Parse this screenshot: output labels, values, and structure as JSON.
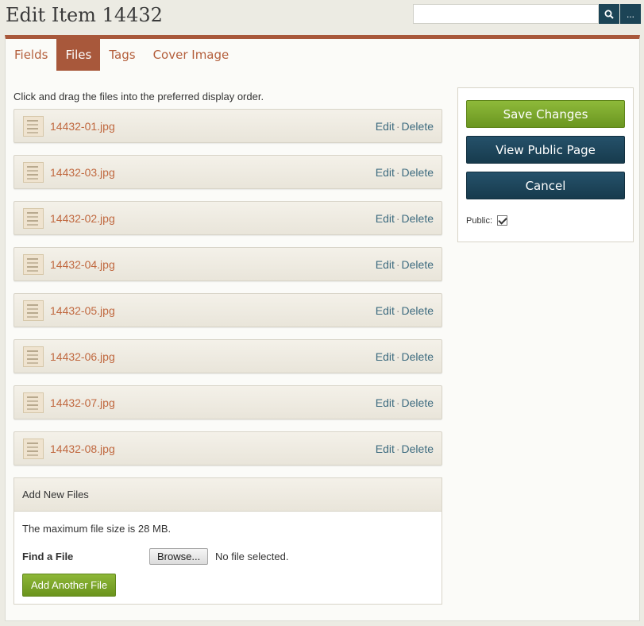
{
  "header": {
    "title": "Edit Item 14432"
  },
  "search": {
    "placeholder": "",
    "search_icon": "search-icon",
    "more_label": "..."
  },
  "tabs": [
    {
      "label": "Fields",
      "active": false
    },
    {
      "label": "Files",
      "active": true
    },
    {
      "label": "Tags",
      "active": false
    },
    {
      "label": "Cover Image",
      "active": false
    }
  ],
  "files": {
    "instructions": "Click and drag the files into the preferred display order.",
    "edit_label": "Edit",
    "separator": "·",
    "delete_label": "Delete",
    "items": [
      {
        "name": "14432-01.jpg"
      },
      {
        "name": "14432-03.jpg"
      },
      {
        "name": "14432-02.jpg"
      },
      {
        "name": "14432-04.jpg"
      },
      {
        "name": "14432-05.jpg"
      },
      {
        "name": "14432-06.jpg"
      },
      {
        "name": "14432-07.jpg"
      },
      {
        "name": "14432-08.jpg"
      }
    ]
  },
  "add_files": {
    "heading": "Add New Files",
    "max_size_text": "The maximum file size is 28 MB.",
    "find_label": "Find a File",
    "browse_label": "Browse...",
    "no_file_text": "No file selected.",
    "add_another_label": "Add Another File"
  },
  "actions": {
    "save_label": "Save Changes",
    "view_public_label": "View Public Page",
    "cancel_label": "Cancel",
    "public_label": "Public:",
    "public_checked": true
  },
  "colors": {
    "accent": "#a8583b",
    "link": "#c0683f",
    "green_button": "#7aa32a",
    "dark_button": "#1c4456"
  }
}
